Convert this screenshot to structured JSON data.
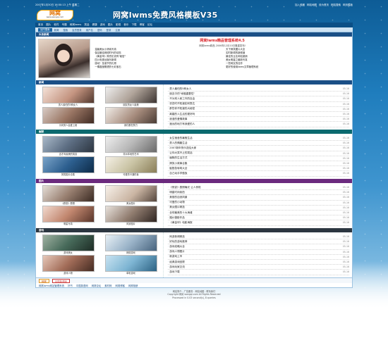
{
  "topbar": {
    "date": "2007年1月30日 16:50:13 上午 星期二",
    "links": [
      "加入收藏",
      "网站地图",
      "设为首页",
      "网站搜索",
      "网页模板"
    ]
  },
  "header": {
    "logo_mark": "网窝",
    "logo_url": "www.wangqi.com",
    "banner": "网窝Iwms免费风格模板V35"
  },
  "nav": [
    "首页",
    "图片",
    "软件",
    "专题",
    "网窝Iwms",
    "笑话",
    "健康",
    "游戏",
    "图片",
    "影视",
    "音乐",
    "下载",
    "博客",
    "论坛"
  ],
  "subbar": {
    "tag": "站内搜索",
    "items": [
      "新闻",
      "搜索",
      "会员登录",
      "用户名",
      "密码",
      "登录",
      "注册"
    ]
  },
  "sections": {
    "top": "头条新闻",
    "news": "新闻",
    "humor": "幽默",
    "photos": "图片",
    "games": "游戏"
  },
  "toprec": {
    "title": "网窝Iwms精品管理系统4.5",
    "desc": "网窝Iwms精品 2006年12月10日隆重发布!",
    "items": [
      "温馨美女小清纯写真",
      "天下搞笑图片大全",
      "保证最佳网络时代的动态",
      "实时新闻的新频道",
      "《黄金甲》周杰伦说有\"秘密\"",
      "最佳的企业网站营销",
      "四川电视台娱乐新闻",
      "美女明星之最新写真",
      "感动！圣诞节的礼物",
      "一些网友的佳作",
      "一棵晶莹剔透的七彩宝石",
      "更好的使用Iwms文章管理系统"
    ]
  },
  "news": {
    "thumbs": [
      {
        "cap": "男人最怕的5种女人"
      },
      {
        "cap": "朋友的女人最美"
      },
      {
        "cap": "为何男人会爱上她"
      },
      {
        "cap": "我们都在努力"
      }
    ],
    "rows": [
      {
        "t": "男人最怕的5种女人",
        "d": "05-16"
      },
      {
        "t": "朋友中的\"幸福重要性\"",
        "d": "05-16"
      },
      {
        "t": "不为别人而工作的自由",
        "d": "05-16"
      },
      {
        "t": "初恋时不知道如何表达",
        "d": "05-16"
      },
      {
        "t": "那些你不知道的大秘密",
        "d": "05-16"
      },
      {
        "t": "离婚的人生活的更好吗",
        "d": "05-16"
      },
      {
        "t": "浪漫的爱情故事",
        "d": "05-16"
      },
      {
        "t": "遥远的地方有我爱的人",
        "d": "05-16"
      }
    ]
  },
  "humor": {
    "thumbs": [
      {
        "cap": "这才叫最美的笑容"
      },
      {
        "cap": "非洲本地的艺术"
      },
      {
        "cap": "搞笑图片合集"
      },
      {
        "cap": "可爱的卡通形象"
      }
    ],
    "rows": [
      {
        "t": "女生宿舍的暑假生活",
        "d": "05-16"
      },
      {
        "t": "男人的情趣生活",
        "d": "05-16"
      },
      {
        "t": "2007新年快乐送给大家",
        "d": "05-16"
      },
      {
        "t": "让你大笑不止的笑话",
        "d": "05-16"
      },
      {
        "t": "幽默的生活方式",
        "d": "05-16"
      },
      {
        "t": "搞笑小故事合集",
        "d": "05-16"
      },
      {
        "t": "脑筋急转弯大全",
        "d": "05-16"
      },
      {
        "t": "自己动手学做饭",
        "d": "05-16"
      }
    ]
  },
  "photos": {
    "thumbs": [
      {
        "cap": "《夜宴》剧照"
      },
      {
        "cap": "美女图片"
      },
      {
        "cap": "明星写真"
      },
      {
        "cap": "风景图片"
      }
    ],
    "rows": [
      {
        "t": "《夜宴》剧照曝光 让人惊艳",
        "d": "05-16"
      },
      {
        "t": "明星时尚街拍",
        "d": "05-16"
      },
      {
        "t": "美丽的自然风景",
        "d": "05-16"
      },
      {
        "t": "可爱的小动物",
        "d": "05-16"
      },
      {
        "t": "美女图片精选",
        "d": "05-16"
      },
      {
        "t": "全球最美的十大海滩",
        "d": "05-16"
      },
      {
        "t": "婚纱摄影作品",
        "d": "05-16"
      },
      {
        "t": "《黄金甲》电影海报",
        "d": "05-16"
      }
    ]
  },
  "games": {
    "thumbs": [
      {
        "cap": "游戏美女"
      },
      {
        "cap": "网络游戏"
      },
      {
        "cap": "游戏人物"
      },
      {
        "cap": "单机游戏"
      }
    ],
    "rows": [
      {
        "t": "网游新闻精选",
        "d": "05-16"
      },
      {
        "t": "好玩的游戏推荐",
        "d": "05-16"
      },
      {
        "t": "游戏攻略大全",
        "d": "05-16"
      },
      {
        "t": "游戏人物图片",
        "d": "05-16"
      },
      {
        "t": "新游戏上市",
        "d": "05-16"
      },
      {
        "t": "经典游戏回顾",
        "d": "05-16"
      },
      {
        "t": "游戏玩家交流",
        "d": "05-16"
      },
      {
        "t": "游戏下载",
        "d": "05-16"
      }
    ]
  },
  "links_section": {
    "chip1": "网窝",
    "chip2": "中国英语网",
    "links": [
      "网窝Iwms网站管理系统",
      "好书",
      "中国英语网",
      "网窝论坛",
      "素材网",
      "网窝博客",
      "网窝相册"
    ]
  },
  "footer": {
    "line1": "网站简介 - 广告服务 - 网站地图 - 联系我们",
    "line2": "Copyright 网窝 wangqi.com All Rights Reserved",
    "line3": "Processed in 0.03 second(s), 8 queries"
  }
}
